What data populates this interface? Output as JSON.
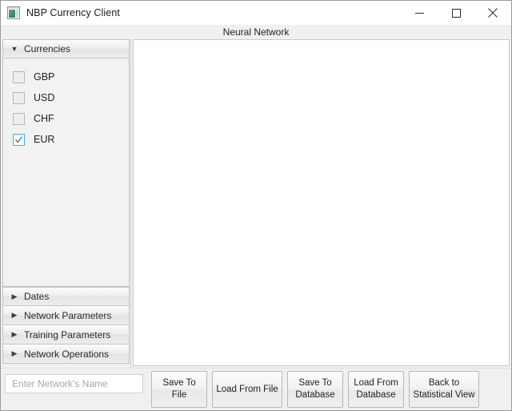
{
  "window": {
    "title": "NBP Currency Client",
    "icon": "app-window-icon",
    "controls": [
      {
        "name": "minimize-button",
        "glyph": "minimize"
      },
      {
        "name": "maximize-button",
        "glyph": "maximize"
      },
      {
        "name": "close-button",
        "glyph": "close"
      }
    ]
  },
  "view": {
    "title": "Neural Network"
  },
  "sidebar": {
    "sections": [
      {
        "label": "Currencies",
        "expanded": true,
        "arrow": "▼",
        "items": [
          {
            "label": "GBP",
            "checked": false
          },
          {
            "label": "USD",
            "checked": false
          },
          {
            "label": "CHF",
            "checked": false
          },
          {
            "label": "EUR",
            "checked": true
          }
        ]
      },
      {
        "label": "Dates",
        "expanded": false,
        "arrow": "▶"
      },
      {
        "label": "Network Parameters",
        "expanded": false,
        "arrow": "▶"
      },
      {
        "label": "Training Parameters",
        "expanded": false,
        "arrow": "▶"
      },
      {
        "label": "Network Operations",
        "expanded": false,
        "arrow": "▶"
      }
    ]
  },
  "content": {
    "empty": ""
  },
  "bottom": {
    "network_name_value": "",
    "network_name_placeholder": "Enter Network's Name",
    "buttons": [
      {
        "label": "Save To File",
        "name": "save-to-file-button"
      },
      {
        "label": "Load From File",
        "name": "load-from-file-button"
      },
      {
        "label": "Save To Database",
        "name": "save-to-database-button"
      },
      {
        "label": "Load From Database",
        "name": "load-from-database-button"
      },
      {
        "label": "Back to Statistical View",
        "name": "back-to-statistical-view-button"
      }
    ]
  },
  "colors": {
    "accent": "#3daee9",
    "window_bg": "#f0f0f0",
    "content_bg": "#ffffff",
    "border": "#c4c4c4"
  }
}
